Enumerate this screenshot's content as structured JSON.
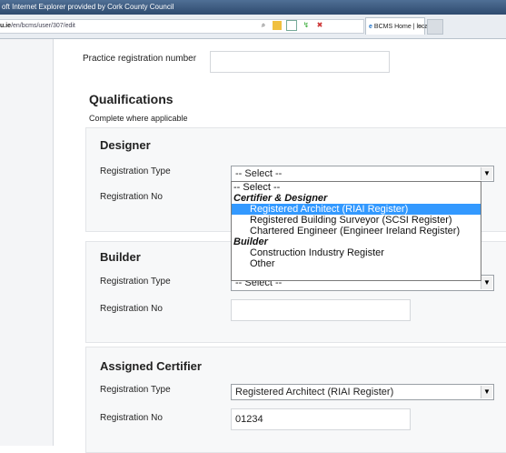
{
  "browser": {
    "title": "oft Internet Explorer provided by Cork County Council",
    "url_host": "u.ie",
    "url_path": "/en/bcms/user/307/edit",
    "tab_label": "BCMS Home | local...",
    "tab_close": "×"
  },
  "form": {
    "practice_reg_label": "Practice registration number",
    "practice_reg_value": "",
    "qualifications_title": "Qualifications",
    "qualifications_subtitle": "Complete where applicable",
    "designer": {
      "title": "Designer",
      "reg_type_label": "Registration Type",
      "reg_type_value": "-- Select --",
      "reg_no_label": "Registration No"
    },
    "dropdown": {
      "options": [
        {
          "label": "-- Select --",
          "kind": "option",
          "indent": false
        },
        {
          "label": "Certifier & Designer",
          "kind": "group"
        },
        {
          "label": "Registered Architect (RIAI Register)",
          "kind": "option",
          "indent": true,
          "selected": true
        },
        {
          "label": "Registered Building Surveyor (SCSI Register)",
          "kind": "option",
          "indent": true
        },
        {
          "label": "Chartered Engineer (Engineer Ireland Register)",
          "kind": "option",
          "indent": true
        },
        {
          "label": "Builder",
          "kind": "group"
        },
        {
          "label": "Construction Industry Register",
          "kind": "option",
          "indent": true
        },
        {
          "label": "Other",
          "kind": "option",
          "indent": true
        }
      ]
    },
    "builder": {
      "title": "Builder",
      "reg_type_label": "Registration Type",
      "reg_type_value": "-- Select --",
      "reg_no_label": "Registration No",
      "reg_no_value": ""
    },
    "certifier": {
      "title": "Assigned Certifier",
      "reg_type_label": "Registration Type",
      "reg_type_value": "Registered Architect (RIAI Register)",
      "reg_no_label": "Registration No",
      "reg_no_value": "01234"
    }
  },
  "colors": {
    "selection": "#3399ff",
    "panel": "#f7f8f9"
  }
}
